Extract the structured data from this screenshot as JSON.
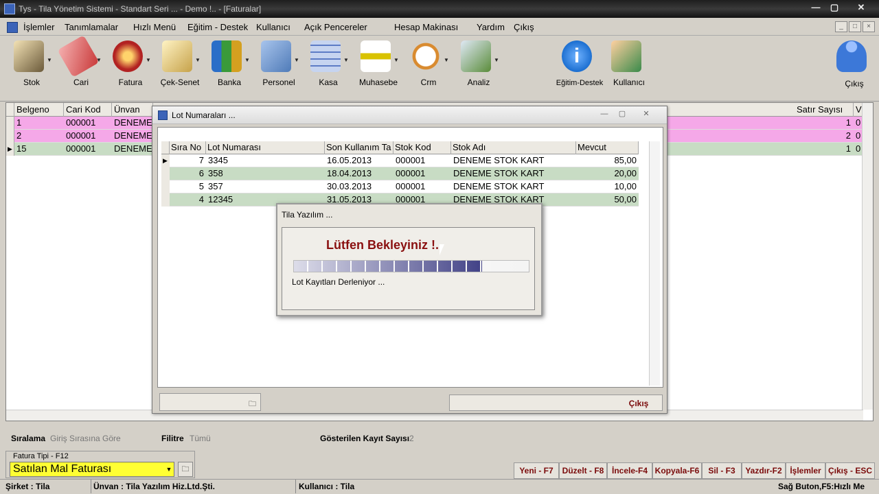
{
  "window": {
    "title": "Tys - Tila Yönetim Sistemi - Standart Seri ... - Demo !.. - [Faturalar]",
    "controls": [
      "minimize",
      "maximize",
      "close"
    ]
  },
  "menu": {
    "items": [
      "İşlemler",
      "Tanımlamalar",
      "Hızlı Menü",
      "Eğitim - Destek",
      "Kullanıcı",
      "Açık Pencereler",
      "Hesap Makinası",
      "Yardım",
      "Çıkış"
    ],
    "mdi_controls": [
      "_",
      "□",
      "×"
    ]
  },
  "toolbar": {
    "items": [
      {
        "label": "Stok",
        "icon": "pencil-notebook-icon",
        "color": "#6b5a3a"
      },
      {
        "label": "Cari",
        "icon": "cari-card-icon",
        "color": "#c93a3a"
      },
      {
        "label": "Fatura",
        "icon": "invoice-box-icon",
        "color": "#b22222"
      },
      {
        "label": "Çek-Senet",
        "icon": "check-document-icon",
        "color": "#c6a24a"
      },
      {
        "label": "Banka",
        "icon": "bank-books-icon",
        "color": "#2a6ec8"
      },
      {
        "label": "Personel",
        "icon": "personnel-icon",
        "color": "#4f7bb8"
      },
      {
        "label": "Kasa",
        "icon": "calculator-icon",
        "color": "#5c7bc5"
      },
      {
        "label": "Muhasebe",
        "icon": "accounting-ruler-icon",
        "color": "#d9c200"
      },
      {
        "label": "Crm",
        "icon": "clock-icon",
        "color": "#d98b30"
      },
      {
        "label": "Analiz",
        "icon": "analysis-globe-icon",
        "color": "#5a8c3a"
      },
      {
        "label": "Eğitim-Destek",
        "icon": "info-icon",
        "color": "#1c6fd1"
      },
      {
        "label": "Kullanıcı",
        "icon": "users-icon",
        "color": "#3a8a4a"
      },
      {
        "label": "Çıkış",
        "icon": "exit-runner-icon",
        "color": "#3c78d8"
      }
    ]
  },
  "main_grid": {
    "columns": [
      "Belgeno",
      "Cari Kod",
      "Ünvan",
      "Satır Sayısı",
      "V"
    ],
    "rows": [
      {
        "belgeno": "1",
        "cari_kod": "000001",
        "unvan": "DENEME",
        "satir": "1",
        "v": "0",
        "color": "#f5a8e8"
      },
      {
        "belgeno": "2",
        "cari_kod": "000001",
        "unvan": "DENEME",
        "satir": "2",
        "v": "0",
        "color": "#f5a8e8"
      },
      {
        "belgeno": "15",
        "cari_kod": "000001",
        "unvan": "DENEME",
        "satir": "1",
        "v": "0",
        "color": "#c8dcc4"
      }
    ]
  },
  "lot_dialog": {
    "title": "Lot Numaraları ...",
    "columns": [
      "Sıra No",
      "Lot Numarası",
      "Son Kullanım Ta",
      "Stok Kod",
      "Stok Adı",
      "Mevcut"
    ],
    "rows": [
      {
        "sira": "7",
        "lot": "3345",
        "son": "16.05.2013",
        "stok_kod": "000001",
        "stok_adi": "DENEME STOK KART",
        "mevcut": "85,00"
      },
      {
        "sira": "6",
        "lot": "358",
        "son": "18.04.2013",
        "stok_kod": "000001",
        "stok_adi": "DENEME STOK KART",
        "mevcut": "20,00"
      },
      {
        "sira": "5",
        "lot": "357",
        "son": "30.03.2013",
        "stok_kod": "000001",
        "stok_adi": "DENEME STOK KART",
        "mevcut": "10,00"
      },
      {
        "sira": "4",
        "lot": "12345",
        "son": "31.05.2013",
        "stok_kod": "000001",
        "stok_adi": "DENEME STOK KART",
        "mevcut": "50,00"
      }
    ],
    "cikis_label": "Çıkış"
  },
  "wait_dialog": {
    "title": "Tila Yazılım ...",
    "message": "Lütfen Bekleyiniz !..",
    "progress": 0.8,
    "subtext": "Lot Kayıtları Derleniyor ..."
  },
  "info_bar": {
    "siralama_label": "Sıralama",
    "siralama_value": "Giriş Sırasına Göre",
    "filitre_label": "Filitre",
    "filitre_value": "Tümü",
    "kayit_label": "Gösterilen Kayıt Sayısı",
    "kayit_value": "2"
  },
  "fatura_tipi": {
    "label": "Fatura Tipi - F12",
    "selected": "Satılan Mal Faturası"
  },
  "function_keys": [
    "Yeni - F7",
    "Düzelt - F8",
    "İncele-F4",
    "Kopyala-F6",
    "Sil - F3",
    "Yazdır-F2",
    "İşlemler",
    "Çıkış - ESC"
  ],
  "status_bar": {
    "sirket": "Şirket : Tila",
    "unvan": "Ünvan : Tila Yazılım Hiz.Ltd.Şti.",
    "kullanici": "Kullanıcı : Tila",
    "hint": "Sağ Buton,F5:Hızlı Me"
  }
}
